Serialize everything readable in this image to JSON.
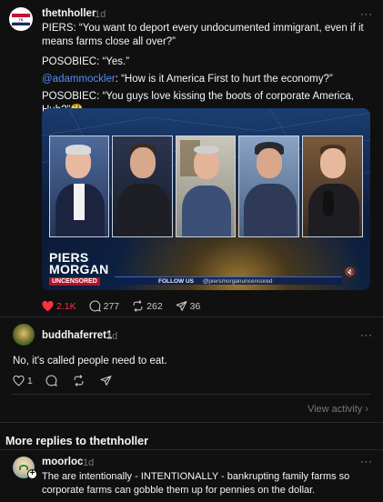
{
  "post": {
    "username": "thetnholler",
    "time": "1d",
    "more_label": "···",
    "avatar_text": "TN FREEDOM",
    "paragraphs": {
      "p1": "PIERS: “You want to deport every undocumented immigrant, even if it means farms close all over?”",
      "p2": "POSOBIEC: “Yes.”",
      "p3_mention": "@adammockler",
      "p3_rest": ": “How is it America First to hurt the economy?”",
      "p4": "POSOBIEC: “You guys love kissing the boots of corporate America, Huh?”🤔"
    },
    "video": {
      "brand_line1": "PIERS",
      "brand_line2": "MORGAN",
      "brand_sub": "UNCENSORED",
      "follow_label": "FOLLOW US",
      "social_handle": "@piersmorganuncensored",
      "mute_icon": "🔇"
    },
    "actions": {
      "likes": "2.1K",
      "comments": "277",
      "reposts": "262",
      "shares": "36"
    }
  },
  "reply": {
    "username": "buddhaferret1",
    "time": "1d",
    "more_label": "···",
    "text": "No, it's called people need to eat.",
    "likes": "1"
  },
  "view_activity": "View activity  ›",
  "section_title": "More replies to thetnholler",
  "reply2": {
    "username": "moorloc",
    "time": "1d",
    "more_label": "···",
    "text": "The are intentionally - INTENTIONALLY - bankrupting family farms so corporate farms can gobble them up for pennies on the dollar."
  },
  "colors": {
    "background": "#101010",
    "text": "#f3f5f7",
    "muted": "#777777",
    "like_red": "#ff3040",
    "mention_blue": "#4f8ff7"
  }
}
